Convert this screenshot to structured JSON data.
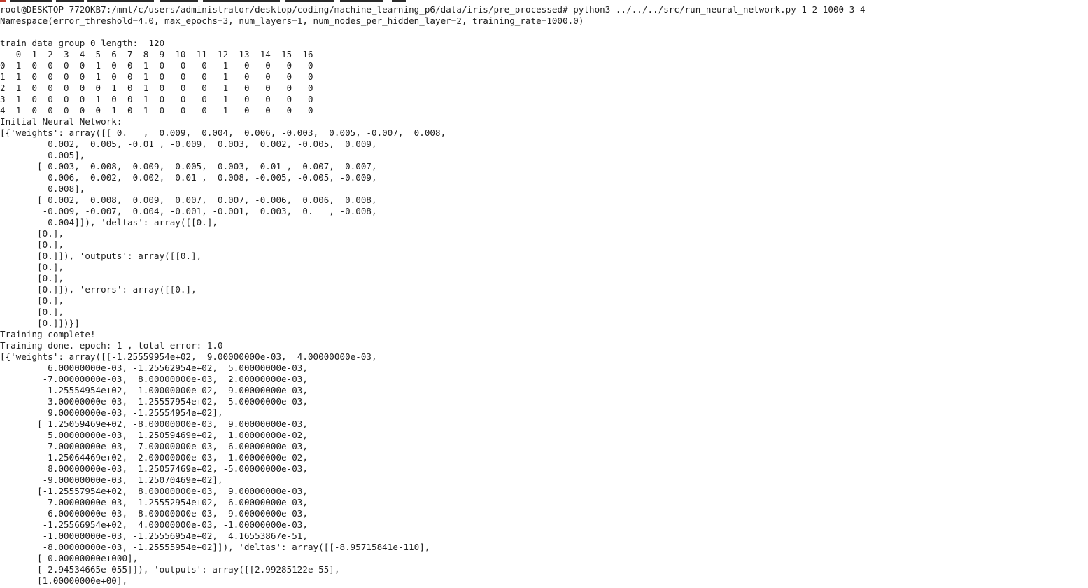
{
  "terminal": {
    "lines": [
      "root@DESKTOP-772OKB7:/mnt/c/users/administrator/desktop/coding/machine_learning_p6/data/iris/pre_processed# python3 ../../../src/run_neural_network.py 1 2 1000 3 4",
      "Namespace(error_threshold=4.0, max_epochs=3, num_layers=1, num_nodes_per_hidden_layer=2, training_rate=1000.0)",
      "",
      "train_data group 0 length:  120",
      "   0  1  2  3  4  5  6  7  8  9  10  11  12  13  14  15  16",
      "0  1  0  0  0  0  1  0  0  1  0   0   0   1   0   0   0   0",
      "1  1  0  0  0  0  1  0  0  1  0   0   0   1   0   0   0   0",
      "2  1  0  0  0  0  0  1  0  1  0   0   0   1   0   0   0   0",
      "3  1  0  0  0  0  1  0  0  1  0   0   0   1   0   0   0   0",
      "4  1  0  0  0  0  0  1  0  1  0   0   0   1   0   0   0   0",
      "Initial Neural Network:",
      "[{'weights': array([[ 0.   ,  0.009,  0.004,  0.006, -0.003,  0.005, -0.007,  0.008,",
      "         0.002,  0.005, -0.01 , -0.009,  0.003,  0.002, -0.005,  0.009,",
      "         0.005],",
      "       [-0.003, -0.008,  0.009,  0.005, -0.003,  0.01 ,  0.007, -0.007,",
      "         0.006,  0.002,  0.002,  0.01 ,  0.008, -0.005, -0.005, -0.009,",
      "         0.008],",
      "       [ 0.002,  0.008,  0.009,  0.007,  0.007, -0.006,  0.006,  0.008,",
      "        -0.009, -0.007,  0.004, -0.001, -0.001,  0.003,  0.   , -0.008,",
      "         0.004]]), 'deltas': array([[0.],",
      "       [0.],",
      "       [0.],",
      "       [0.]]), 'outputs': array([[0.],",
      "       [0.],",
      "       [0.],",
      "       [0.]]), 'errors': array([[0.],",
      "       [0.],",
      "       [0.],",
      "       [0.]])}]",
      "Training complete!",
      "Training done. epoch: 1 , total error: 1.0",
      "[{'weights': array([[-1.25559954e+02,  9.00000000e-03,  4.00000000e-03,",
      "         6.00000000e-03, -1.25562954e+02,  5.00000000e-03,",
      "        -7.00000000e-03,  8.00000000e-03,  2.00000000e-03,",
      "        -1.25554954e+02, -1.00000000e-02, -9.00000000e-03,",
      "         3.00000000e-03, -1.25557954e+02, -5.00000000e-03,",
      "         9.00000000e-03, -1.25554954e+02],",
      "       [ 1.25059469e+02, -8.00000000e-03,  9.00000000e-03,",
      "         5.00000000e-03,  1.25059469e+02,  1.00000000e-02,",
      "         7.00000000e-03, -7.00000000e-03,  6.00000000e-03,",
      "         1.25064469e+02,  2.00000000e-03,  1.00000000e-02,",
      "         8.00000000e-03,  1.25057469e+02, -5.00000000e-03,",
      "        -9.00000000e-03,  1.25070469e+02],",
      "       [-1.25557954e+02,  8.00000000e-03,  9.00000000e-03,",
      "         7.00000000e-03, -1.25552954e+02, -6.00000000e-03,",
      "         6.00000000e-03,  8.00000000e-03, -9.00000000e-03,",
      "        -1.25566954e+02,  4.00000000e-03, -1.00000000e-03,",
      "        -1.00000000e-03, -1.25556954e+02,  4.16553867e-51,",
      "        -8.00000000e-03, -1.25555954e+02]]), 'deltas': array([[-8.95715841e-110],",
      "       [-0.00000000e+000],",
      "       [ 2.94534665e-055]]), 'outputs': array([[2.99285122e-55],",
      "       [1.00000000e+00],"
    ]
  }
}
